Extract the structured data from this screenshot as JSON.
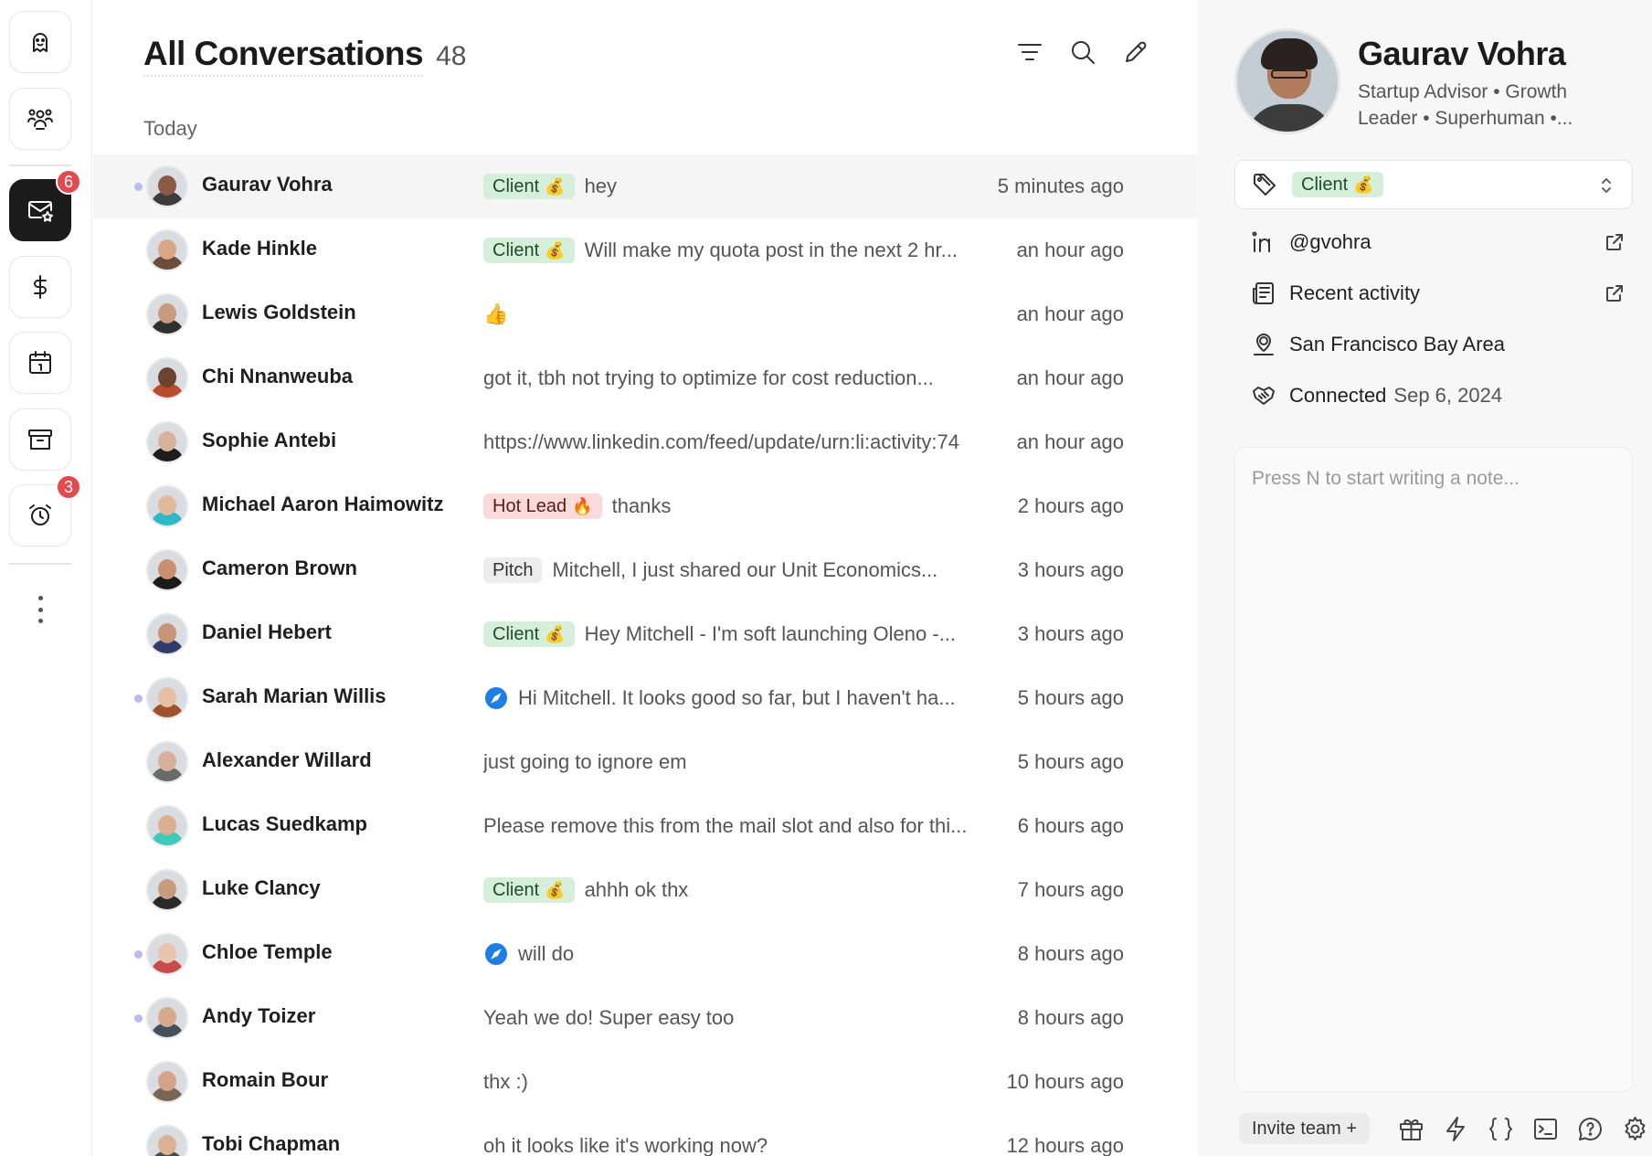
{
  "nav": {
    "inbox_badge": "6",
    "reminders_badge": "3"
  },
  "header": {
    "title": "All Conversations",
    "count": "48"
  },
  "section_label": "Today",
  "conversations": [
    {
      "name": "Gaurav Vohra",
      "tag": "Client",
      "tag_emoji": "💰",
      "tag_kind": "client",
      "preview": "hey",
      "time": "5 minutes ago",
      "unread": true,
      "selected": true,
      "skin": "#8a5a44",
      "shirt": "#3c3c3c"
    },
    {
      "name": "Kade Hinkle",
      "tag": "Client",
      "tag_emoji": "💰",
      "tag_kind": "client",
      "preview": "Will make my quota post in the next 2 hr...",
      "time": "an hour ago",
      "unread": false,
      "selected": false,
      "skin": "#d9a688",
      "shirt": "#6b4d3a"
    },
    {
      "name": "Lewis Goldstein",
      "tag": "",
      "tag_emoji": "",
      "tag_kind": "",
      "preview": "👍",
      "time": "an hour ago",
      "unread": false,
      "selected": false,
      "skin": "#c99a7f",
      "shirt": "#2f2f2f"
    },
    {
      "name": "Chi Nnanweuba",
      "tag": "",
      "tag_emoji": "",
      "tag_kind": "",
      "preview": "got it, tbh not trying to optimize for cost reduction...",
      "time": "an hour ago",
      "unread": false,
      "selected": false,
      "skin": "#6d4230",
      "shirt": "#b84e2e"
    },
    {
      "name": "Sophie Antebi",
      "tag": "",
      "tag_emoji": "",
      "tag_kind": "",
      "preview": "https://www.linkedin.com/feed/update/urn:li:activity:74",
      "time": "an hour ago",
      "unread": false,
      "selected": false,
      "skin": "#d8b39c",
      "shirt": "#1d1d1d"
    },
    {
      "name": "Michael Aaron Haimowitz",
      "tag": "Hot Lead",
      "tag_emoji": "🔥",
      "tag_kind": "hot",
      "preview": "thanks",
      "time": "2 hours ago",
      "unread": false,
      "selected": false,
      "skin": "#e0b89a",
      "shirt": "#2fb7c7"
    },
    {
      "name": "Cameron Brown",
      "tag": "Pitch",
      "tag_emoji": "",
      "tag_kind": "pitch",
      "preview": "Mitchell, I just shared our Unit Economics...",
      "time": "3 hours ago",
      "unread": false,
      "selected": false,
      "skin": "#c98f70",
      "shirt": "#1b1b1b"
    },
    {
      "name": "Daniel Hebert",
      "tag": "Client",
      "tag_emoji": "💰",
      "tag_kind": "client",
      "preview": "Hey Mitchell - I'm soft launching Oleno -...",
      "time": "3 hours ago",
      "unread": false,
      "selected": false,
      "skin": "#c69477",
      "shirt": "#2e3d6b"
    },
    {
      "name": "Sarah Marian Willis",
      "tag": "",
      "tag_emoji": "",
      "tag_kind": "li",
      "preview": "Hi Mitchell.  It looks good so far, but I haven't ha...",
      "time": "5 hours ago",
      "unread": true,
      "selected": false,
      "skin": "#e6bfa3",
      "shirt": "#a0522d"
    },
    {
      "name": "Alexander Willard",
      "tag": "",
      "tag_emoji": "",
      "tag_kind": "",
      "preview": "just going to ignore em",
      "time": "5 hours ago",
      "unread": false,
      "selected": false,
      "skin": "#d6b09a",
      "shirt": "#6a6a6a"
    },
    {
      "name": "Lucas Suedkamp",
      "tag": "",
      "tag_emoji": "",
      "tag_kind": "",
      "preview": "Please remove this from the mail slot and also for thi...",
      "time": "6 hours ago",
      "unread": false,
      "selected": false,
      "skin": "#dcae92",
      "shirt": "#3fc9b8"
    },
    {
      "name": "Luke Clancy",
      "tag": "Client",
      "tag_emoji": "💰",
      "tag_kind": "client",
      "preview": "ahhh ok thx",
      "time": "7 hours ago",
      "unread": false,
      "selected": false,
      "skin": "#c99c80",
      "shirt": "#2a2a2a"
    },
    {
      "name": "Chloe Temple",
      "tag": "",
      "tag_emoji": "",
      "tag_kind": "li",
      "preview": "will do",
      "time": "8 hours ago",
      "unread": true,
      "selected": false,
      "skin": "#e8c5ad",
      "shirt": "#c94b4b"
    },
    {
      "name": "Andy Toizer",
      "tag": "",
      "tag_emoji": "",
      "tag_kind": "",
      "preview": "Yeah we do! Super easy too",
      "time": "8 hours ago",
      "unread": true,
      "selected": false,
      "skin": "#d7a98c",
      "shirt": "#44505c"
    },
    {
      "name": "Romain Bour",
      "tag": "",
      "tag_emoji": "",
      "tag_kind": "",
      "preview": "thx :)",
      "time": "10 hours ago",
      "unread": false,
      "selected": false,
      "skin": "#d3a588",
      "shirt": "#7a6552"
    },
    {
      "name": "Tobi Chapman",
      "tag": "",
      "tag_emoji": "",
      "tag_kind": "",
      "preview": "oh it looks like it's working now?",
      "time": "12 hours ago",
      "unread": false,
      "selected": false,
      "skin": "#dbb095",
      "shirt": "#4a4a4a"
    }
  ],
  "profile": {
    "name": "Gaurav Vohra",
    "headline": "Startup Advisor • Growth Leader • Superhuman •...",
    "tag": "Client",
    "tag_emoji": "💰",
    "linkedin_handle": "@gvohra",
    "recent_activity": "Recent activity",
    "location": "San Francisco Bay Area",
    "connected_label": "Connected",
    "connected_date": "Sep 6, 2024"
  },
  "notes": {
    "placeholder": "Press N to start writing a note..."
  },
  "footer": {
    "invite_label": "Invite team +"
  },
  "colors": {
    "client_tag_bg": "#d6efdb",
    "hot_tag_bg": "#fbdada",
    "pitch_tag_bg": "#ededed",
    "badge": "#e5484d",
    "unread_dot": "#b9bcf3",
    "linkedin_blue": "#1d7fe6"
  }
}
